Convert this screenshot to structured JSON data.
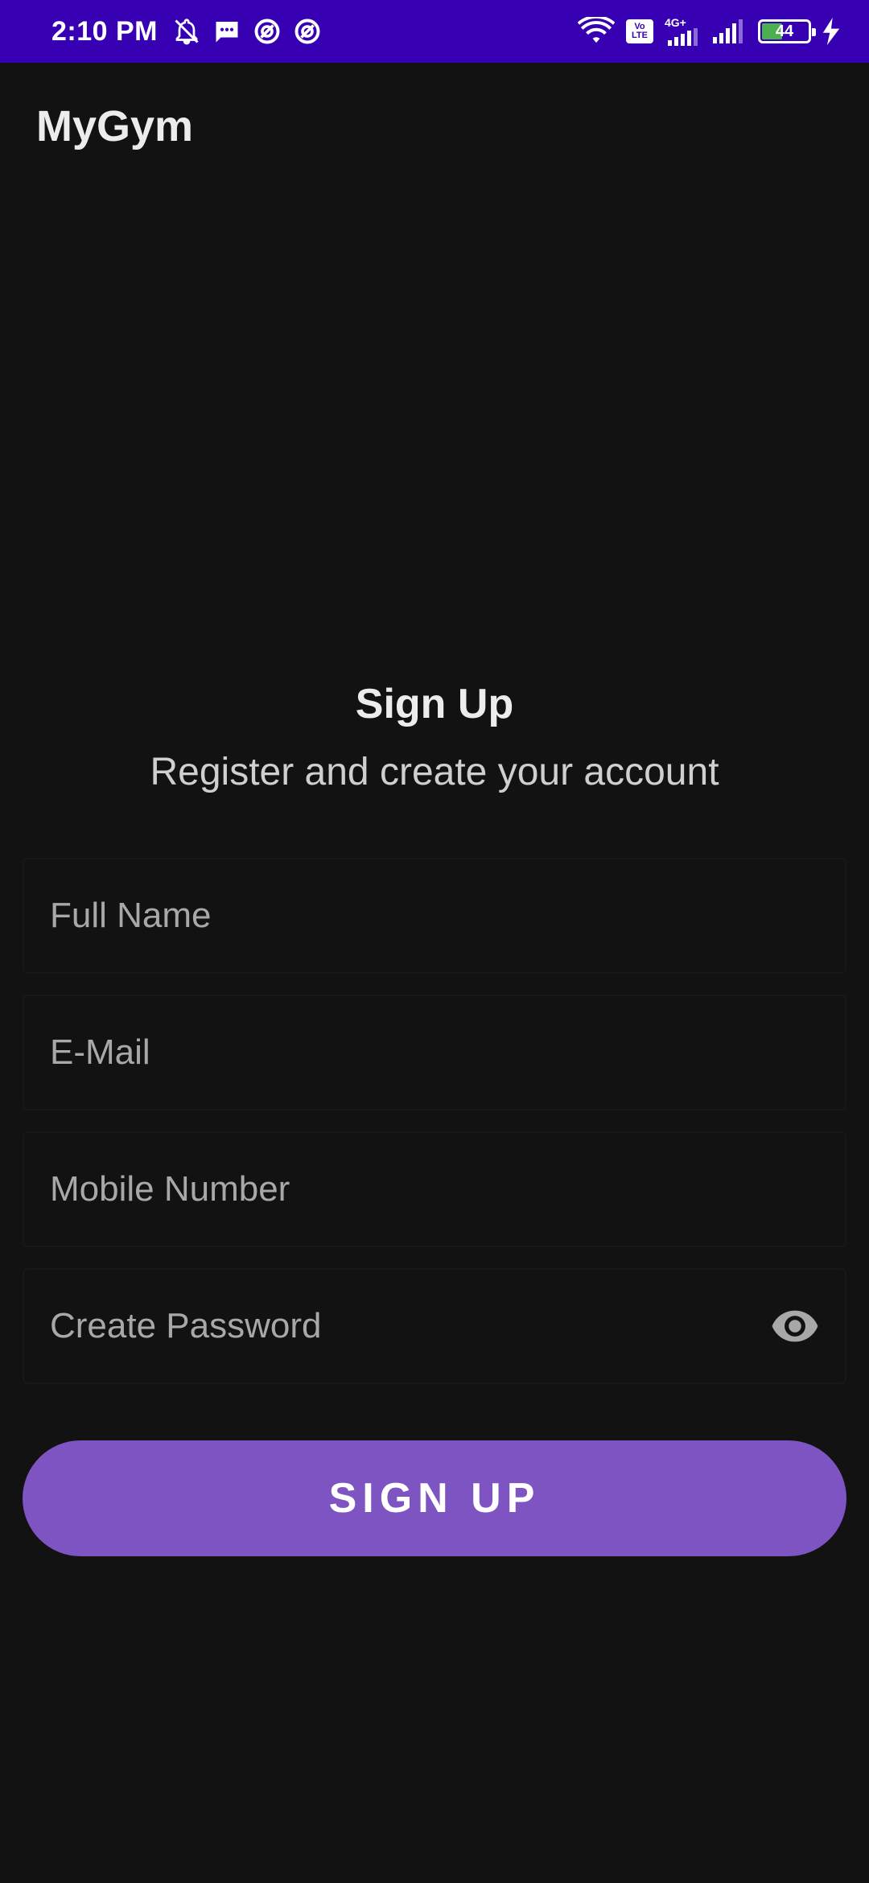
{
  "status_bar": {
    "time": "2:10 PM",
    "battery_level": "44",
    "network_type": "4G+",
    "volte_label_1": "Vo",
    "volte_label_2": "LTE",
    "colors": {
      "background": "#3700b3",
      "battery_fill": "#4caf50"
    },
    "left_icons": [
      "mute-bell-icon",
      "message-icon",
      "data-saver-icon",
      "data-saver-icon"
    ],
    "right_icons": [
      "wifi-icon",
      "volte-icon",
      "signal-4g-icon",
      "signal-icon",
      "battery-icon",
      "charging-icon"
    ]
  },
  "app_bar": {
    "title": "MyGym"
  },
  "form": {
    "heading": "Sign Up",
    "subheading": "Register and create your account",
    "full_name": {
      "placeholder": "Full Name",
      "value": ""
    },
    "email": {
      "placeholder": "E-Mail",
      "value": ""
    },
    "mobile": {
      "placeholder": "Mobile Number",
      "value": ""
    },
    "password": {
      "placeholder": "Create Password",
      "value": "",
      "toggle_icon": "eye-icon"
    },
    "submit_label": "SIGN UP"
  },
  "theme": {
    "background": "#121212",
    "accent": "#7e54c3"
  }
}
